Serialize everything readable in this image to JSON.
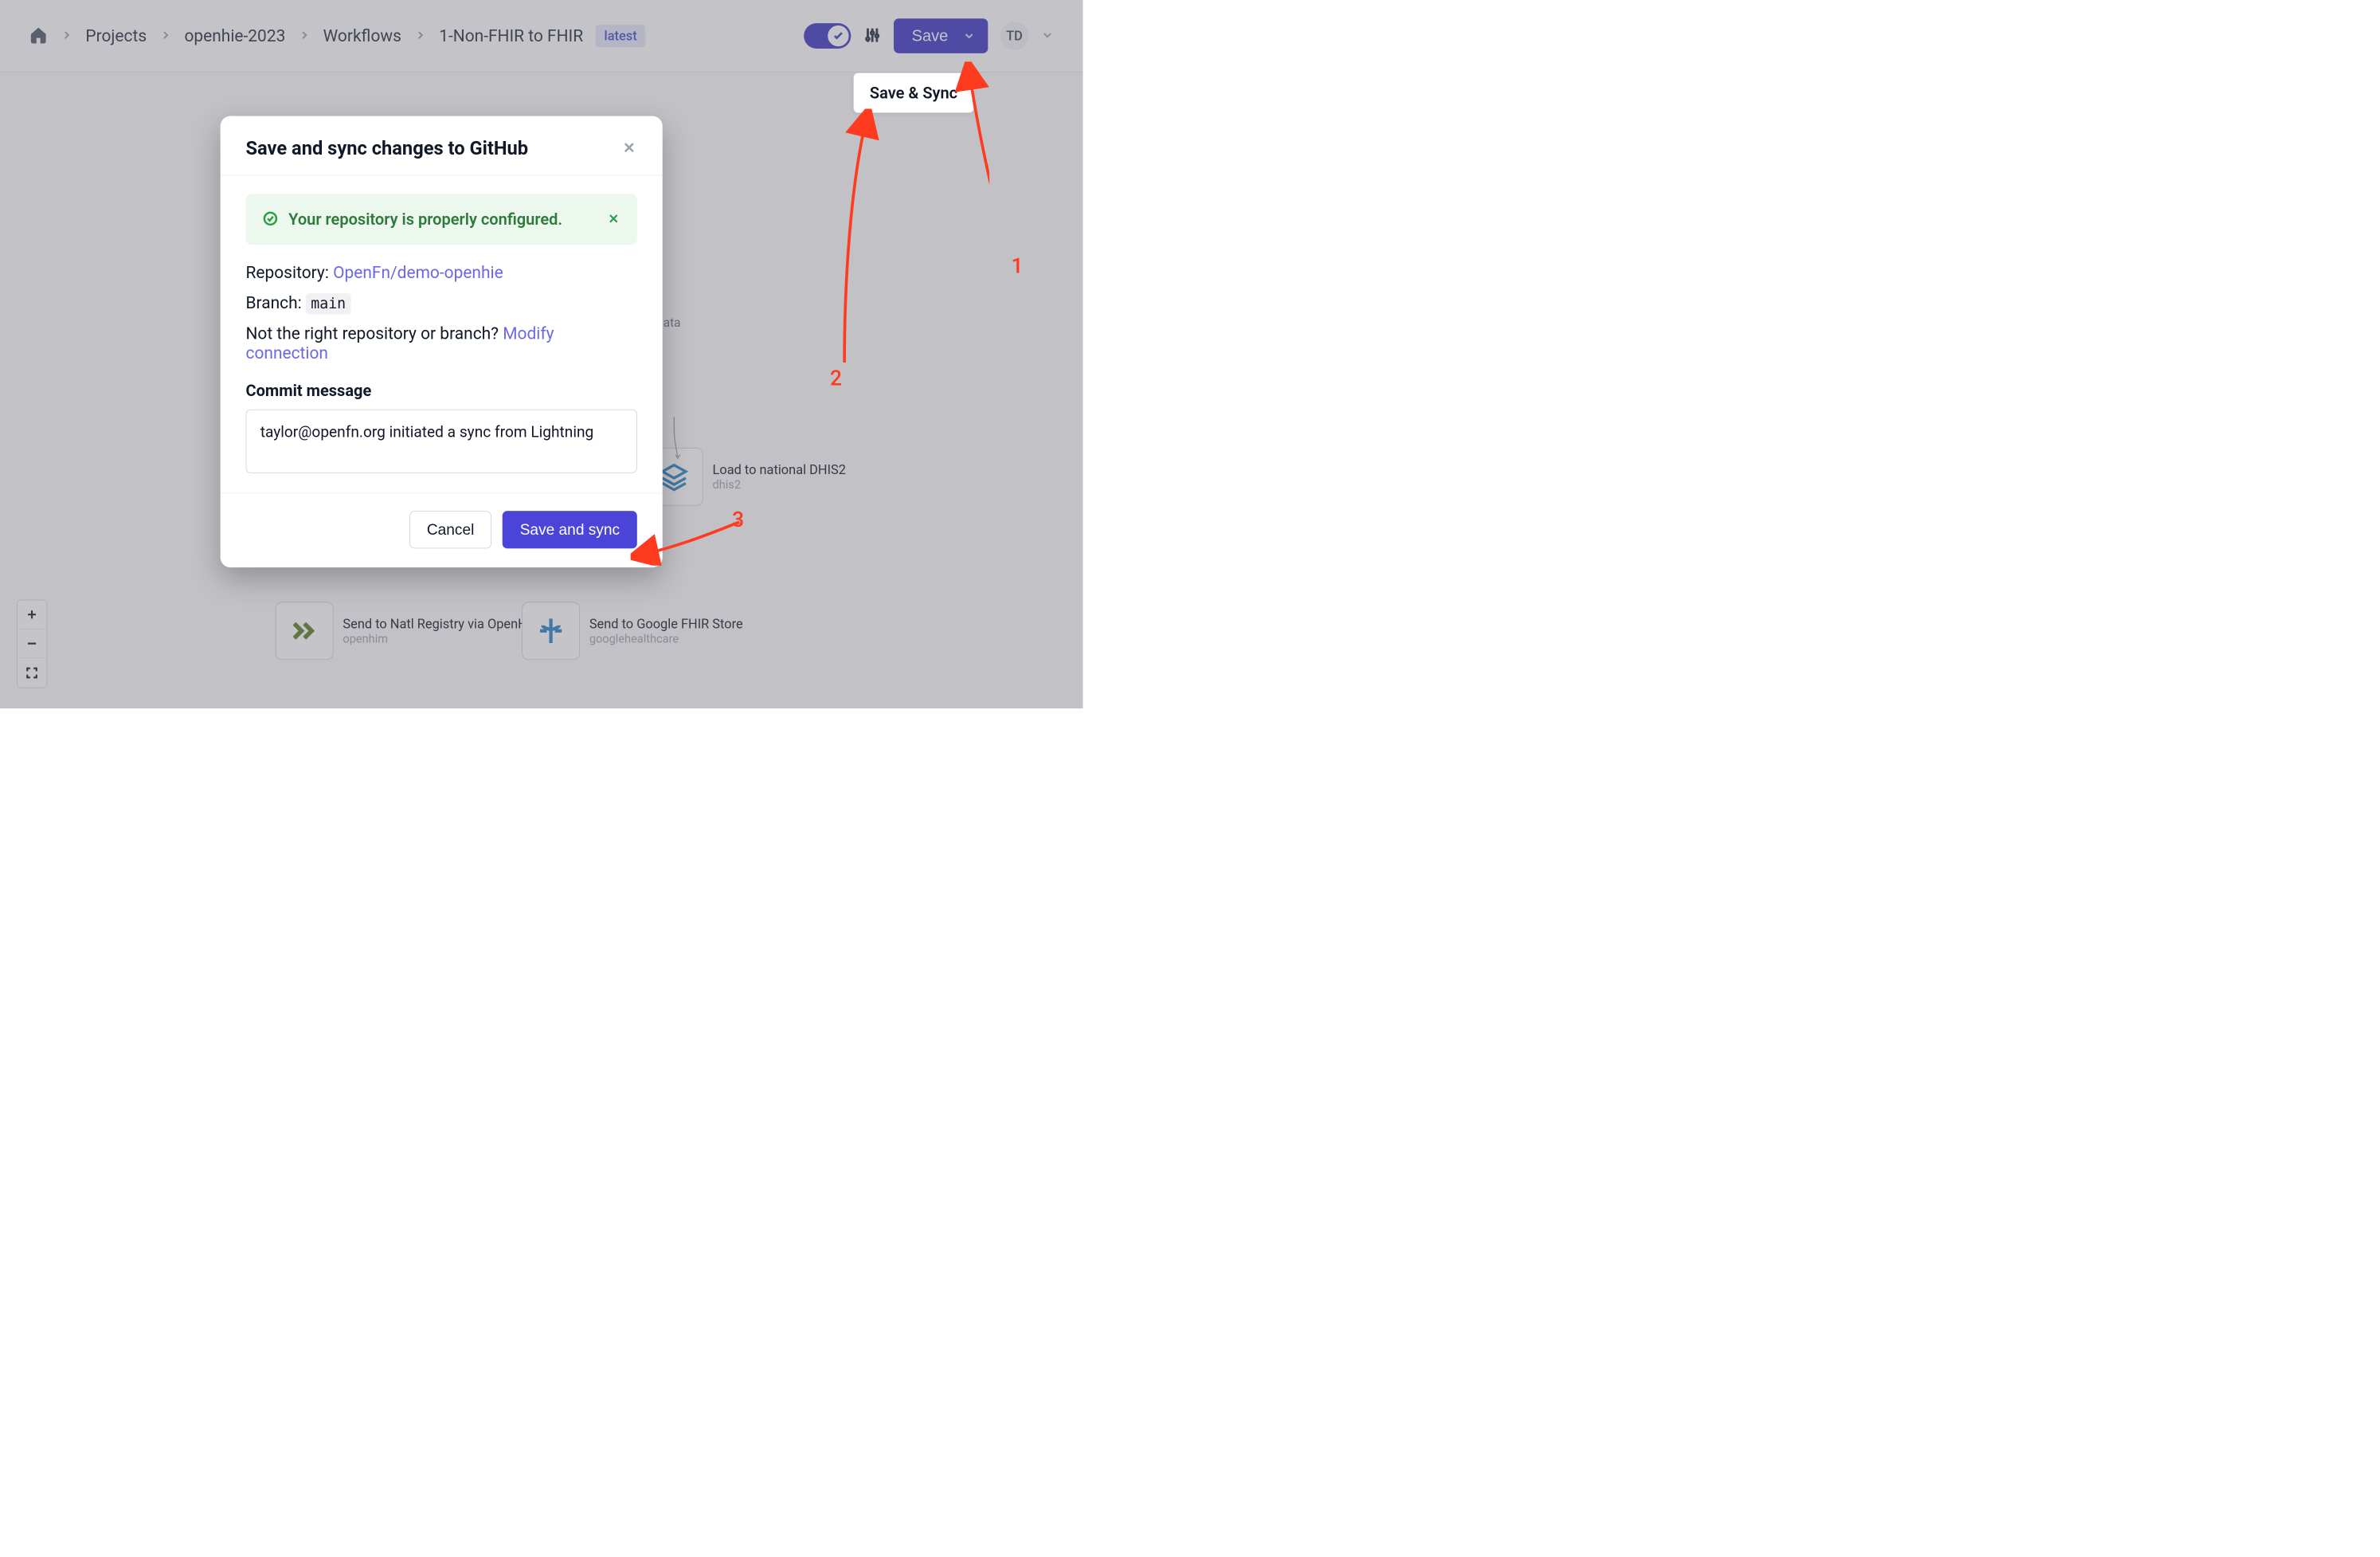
{
  "breadcrumbs": {
    "projects": "Projects",
    "project": "openhie-2023",
    "workflows": "Workflows",
    "workflow": "1-Non-FHIR to FHIR",
    "badge": "latest"
  },
  "topbar": {
    "save_label": "Save",
    "avatar_initials": "TD"
  },
  "dropdown": {
    "save_sync_label": "Save & Sync"
  },
  "modal": {
    "title": "Save and sync changes to GitHub",
    "alert": "Your repository is properly configured.",
    "repo_label": "Repository:",
    "repo_link": "OpenFn/demo-openhie",
    "branch_label": "Branch:",
    "branch_value": "main",
    "modify_prefix": "Not the right repository or branch? ",
    "modify_link": "Modify connection",
    "commit_label": "Commit message",
    "commit_value": "taylor@openfn.org initiated a sync from Lightning",
    "cancel": "Cancel",
    "confirm": "Save and sync"
  },
  "canvas": {
    "partial_label_right": "ata",
    "node_dhis2_title": "Load to national DHIS2",
    "node_dhis2_sub": "dhis2",
    "node_openhim_title": "Send to Natl Registry via OpenHIM",
    "node_openhim_sub": "openhim",
    "node_google_title": "Send to Google FHIR Store",
    "node_google_sub": "googlehealthcare"
  },
  "annotations": {
    "n1": "1",
    "n2": "2",
    "n3": "3"
  }
}
